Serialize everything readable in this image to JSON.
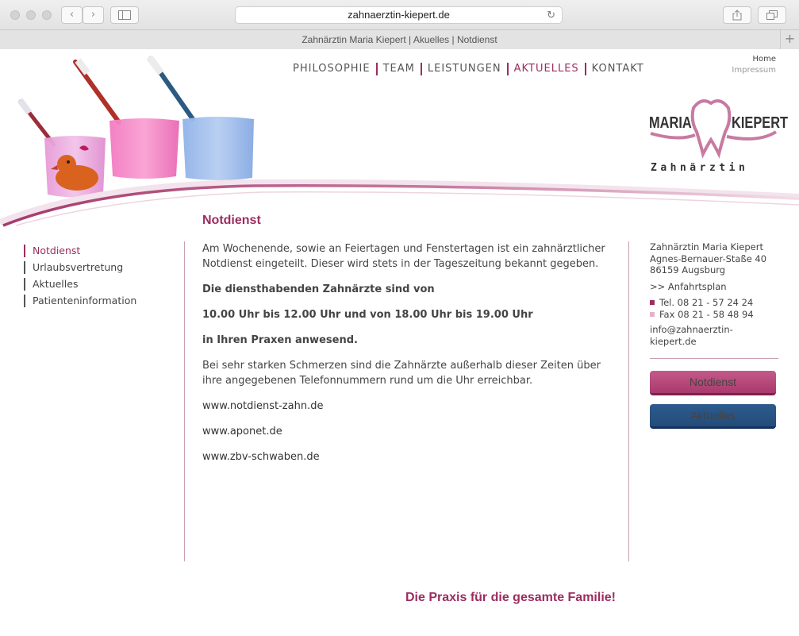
{
  "browser": {
    "url": "zahnaerztin-kiepert.de",
    "tab_title": "Zahnärztin Maria Kiepert | Akuelles | Notdienst",
    "new_tab_label": "+"
  },
  "nav": {
    "items": [
      {
        "label": "PHILOSOPHIE"
      },
      {
        "label": "TEAM"
      },
      {
        "label": "LEISTUNGEN"
      },
      {
        "label": "AKTUELLES"
      },
      {
        "label": "KONTAKT"
      }
    ],
    "home": "Home",
    "impressum": "Impressum"
  },
  "logo": {
    "first": "MARIA",
    "last": "KIEPERT",
    "sub": "Zahnärztin"
  },
  "page_title": "Notdienst",
  "subnav": {
    "items": [
      {
        "label": "Notdienst"
      },
      {
        "label": "Urlaubsvertretung"
      },
      {
        "label": "Aktuelles"
      },
      {
        "label": "Patienteninformation"
      }
    ]
  },
  "content": {
    "p1": "Am Wochenende, sowie an Feiertagen und Fenstertagen ist ein zahnärztlicher Notdienst eingeteilt. Dieser wird stets in der Tageszeitung bekannt gegeben.",
    "b1": "Die diensthabenden Zahnärzte sind von",
    "b2": "10.00 Uhr bis 12.00 Uhr und von 18.00 Uhr bis 19.00 Uhr",
    "b3": "in Ihren Praxen anwesend.",
    "p2": "Bei sehr starken Schmerzen sind die Zahnärzte außerhalb dieser Zeiten über ihre angegebenen Telefonnummern rund um die Uhr erreichbar.",
    "links": [
      "www.notdienst-zahn.de",
      "www.aponet.de",
      "www.zbv-schwaben.de"
    ]
  },
  "contact": {
    "name": "Zahnärztin Maria Kiepert",
    "street": "Agnes-Bernauer-Staße 40",
    "city": "86159 Augsburg",
    "route": ">> Anfahrtsplan",
    "tel": "Tel. 08 21 - 57 24 24",
    "fax": "Fax 08 21 - 58 48 94",
    "email": "info@zahnaerztin-kiepert.de"
  },
  "buttons": {
    "notdienst": "Notdienst",
    "aktuelles": "Aktuelles"
  },
  "tagline": "Die Praxis für die gesamte Familie!",
  "colors": {
    "accent": "#9b2d5f",
    "tel_marker": "#9b2d5f",
    "fax_marker": "#e3b3cc",
    "button_pink": "#b34476",
    "button_blue": "#264f7d"
  }
}
